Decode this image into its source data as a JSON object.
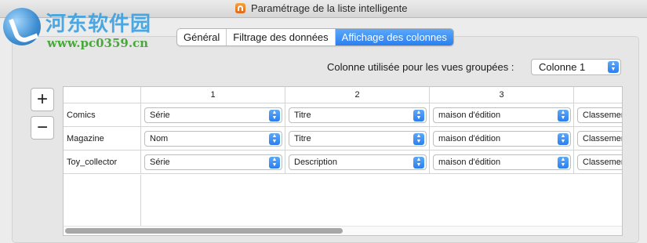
{
  "window": {
    "title": "Paramétrage de la liste intelligente"
  },
  "watermark": {
    "text_cn": "河东软件园",
    "url": "www.pc0359.cn"
  },
  "tabs": [
    {
      "label": "Général",
      "active": false
    },
    {
      "label": "Filtrage des données",
      "active": false
    },
    {
      "label": "Affichage des colonnes",
      "active": true
    }
  ],
  "grouped": {
    "label": "Colonne utilisée pour les vues groupées :",
    "value": "Colonne 1"
  },
  "buttons": {
    "add": "+",
    "remove": "−"
  },
  "columns": [
    "1",
    "2",
    "3"
  ],
  "rows": [
    {
      "label": "Comics",
      "cells": [
        "Série",
        "Titre",
        "maison d'édition",
        "Classement"
      ]
    },
    {
      "label": "Magazine",
      "cells": [
        "Nom",
        "Titre",
        "maison d'édition",
        "Classement"
      ]
    },
    {
      "label": "Toy_collector",
      "cells": [
        "Série",
        "Description",
        "maison d'édition",
        "Classement"
      ]
    }
  ],
  "colors": {
    "accent": "#2a7ff0",
    "watermark_blue": "#3aa0e0",
    "watermark_green": "#48a93a"
  }
}
